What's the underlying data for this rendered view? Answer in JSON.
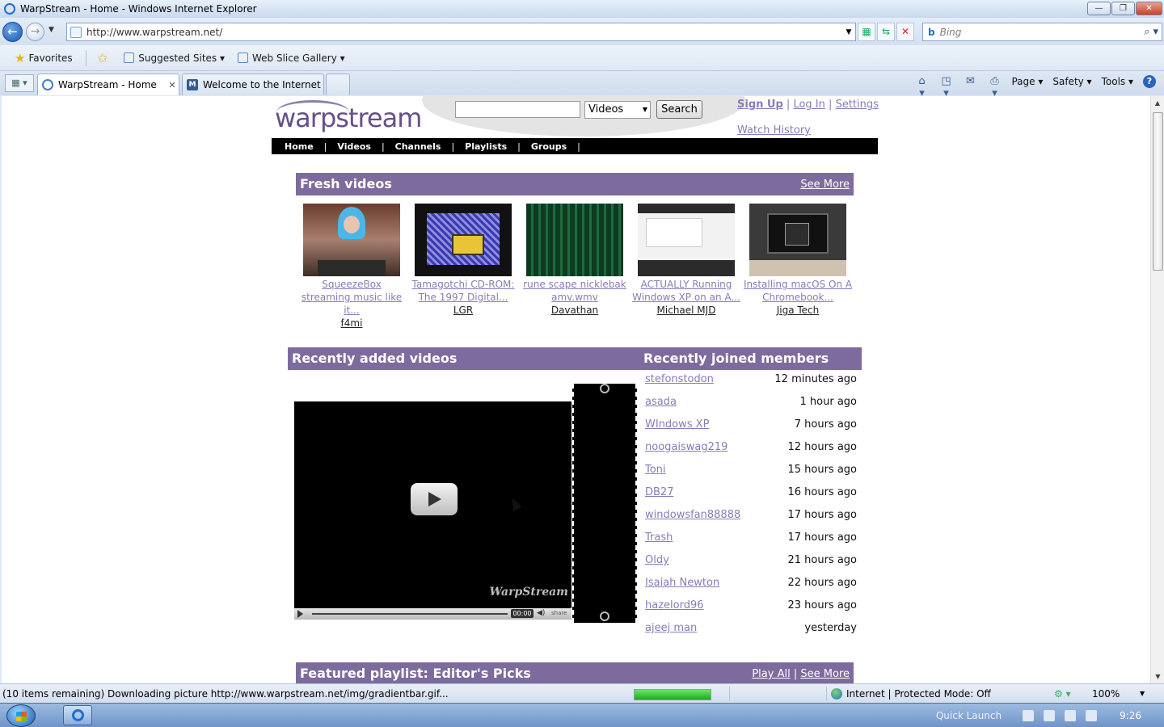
{
  "window": {
    "title": "WarpStream - Home - Windows Internet Explorer",
    "min_glyph": "—",
    "restore_glyph": "❐",
    "close_glyph": "✕"
  },
  "nav": {
    "url": "http://www.warpstream.net/",
    "search_placeholder": "Bing"
  },
  "favorites_bar": {
    "favorites_label": "Favorites",
    "suggested_sites": "Suggested Sites ▾",
    "web_slice_gallery": "Web Slice Gallery ▾"
  },
  "tabs": [
    {
      "label": "WarpStream - Home",
      "active": true
    },
    {
      "label": "Welcome to the Internet E...",
      "active": false
    }
  ],
  "command_bar": {
    "page": "Page ▾",
    "safety": "Safety ▾",
    "tools": "Tools ▾",
    "help": "?"
  },
  "site": {
    "logo": "warpstream",
    "search_value": "",
    "search_type": "Videos",
    "search_button": "Search",
    "sign_up": "Sign Up",
    "log_in": "Log In",
    "settings": "Settings",
    "separator": "|",
    "watch_history": "Watch History",
    "menu": [
      "Home",
      "Videos",
      "Channels",
      "Playlists",
      "Groups"
    ],
    "menu_separator": "|",
    "fresh_videos": {
      "heading": "Fresh videos",
      "see_more": "See More",
      "items": [
        {
          "title": "SqueezeBox streaming music like it...",
          "author": "f4mi"
        },
        {
          "title": "Tamagotchi CD-ROM: The 1997 Digital...",
          "author": "LGR"
        },
        {
          "title": "rune scape nicklebak amv.wmv",
          "author": "Davathan"
        },
        {
          "title": "ACTUALLY Running Windows XP on an A...",
          "author": "Michael MJD"
        },
        {
          "title": "Installing macOS On A Chromebook...",
          "author": "Jiga Tech"
        }
      ]
    },
    "recently_added": {
      "heading": "Recently added videos",
      "player_brand": "WarpStream",
      "player_time": "00:00",
      "player_share": "share"
    },
    "recently_joined": {
      "heading": "Recently joined members",
      "members": [
        {
          "name": "stefonstodon",
          "joined": "12 minutes ago"
        },
        {
          "name": "asada",
          "joined": "1 hour ago"
        },
        {
          "name": "WIndows XP",
          "joined": "7 hours ago"
        },
        {
          "name": "noogaiswag219",
          "joined": "12 hours ago"
        },
        {
          "name": "Toni",
          "joined": "15 hours ago"
        },
        {
          "name": "DB27",
          "joined": "16 hours ago"
        },
        {
          "name": "windowsfan88888",
          "joined": "17 hours ago"
        },
        {
          "name": "Trash",
          "joined": "17 hours ago"
        },
        {
          "name": "Oldy",
          "joined": "21 hours ago"
        },
        {
          "name": "Isaiah Newton",
          "joined": "22 hours ago"
        },
        {
          "name": "hazelord96",
          "joined": "23 hours ago"
        },
        {
          "name": "ajeej man",
          "joined": "yesterday"
        }
      ]
    },
    "featured": {
      "heading": "Featured playlist: Editor's Picks",
      "play_all": "Play All",
      "see_more": "See More"
    }
  },
  "status_bar": {
    "message": "(10 items remaining) Downloading picture http://www.warpstream.net/img/gradientbar.gif...",
    "progress": 1.0,
    "zone": "Internet | Protected Mode: Off",
    "zoom": "100%"
  },
  "taskbar": {
    "quick_launch": "Quick Launch",
    "clock": "9:26"
  }
}
